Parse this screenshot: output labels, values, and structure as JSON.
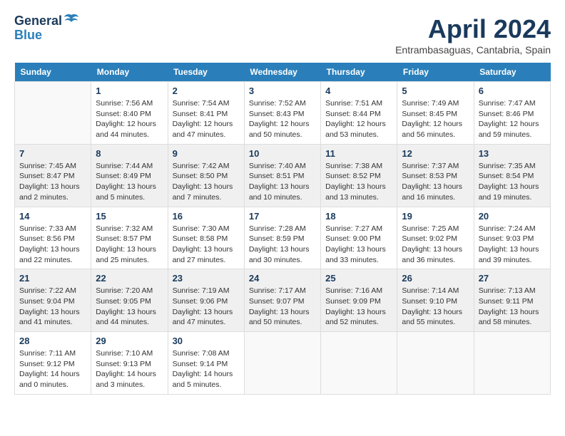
{
  "header": {
    "logo_line1": "General",
    "logo_line2": "Blue",
    "month_title": "April 2024",
    "location": "Entrambasaguas, Cantabria, Spain"
  },
  "days_of_week": [
    "Sunday",
    "Monday",
    "Tuesday",
    "Wednesday",
    "Thursday",
    "Friday",
    "Saturday"
  ],
  "weeks": [
    {
      "days": [
        {
          "number": "",
          "info": ""
        },
        {
          "number": "1",
          "info": "Sunrise: 7:56 AM\nSunset: 8:40 PM\nDaylight: 12 hours\nand 44 minutes."
        },
        {
          "number": "2",
          "info": "Sunrise: 7:54 AM\nSunset: 8:41 PM\nDaylight: 12 hours\nand 47 minutes."
        },
        {
          "number": "3",
          "info": "Sunrise: 7:52 AM\nSunset: 8:43 PM\nDaylight: 12 hours\nand 50 minutes."
        },
        {
          "number": "4",
          "info": "Sunrise: 7:51 AM\nSunset: 8:44 PM\nDaylight: 12 hours\nand 53 minutes."
        },
        {
          "number": "5",
          "info": "Sunrise: 7:49 AM\nSunset: 8:45 PM\nDaylight: 12 hours\nand 56 minutes."
        },
        {
          "number": "6",
          "info": "Sunrise: 7:47 AM\nSunset: 8:46 PM\nDaylight: 12 hours\nand 59 minutes."
        }
      ]
    },
    {
      "days": [
        {
          "number": "7",
          "info": "Sunrise: 7:45 AM\nSunset: 8:47 PM\nDaylight: 13 hours\nand 2 minutes."
        },
        {
          "number": "8",
          "info": "Sunrise: 7:44 AM\nSunset: 8:49 PM\nDaylight: 13 hours\nand 5 minutes."
        },
        {
          "number": "9",
          "info": "Sunrise: 7:42 AM\nSunset: 8:50 PM\nDaylight: 13 hours\nand 7 minutes."
        },
        {
          "number": "10",
          "info": "Sunrise: 7:40 AM\nSunset: 8:51 PM\nDaylight: 13 hours\nand 10 minutes."
        },
        {
          "number": "11",
          "info": "Sunrise: 7:38 AM\nSunset: 8:52 PM\nDaylight: 13 hours\nand 13 minutes."
        },
        {
          "number": "12",
          "info": "Sunrise: 7:37 AM\nSunset: 8:53 PM\nDaylight: 13 hours\nand 16 minutes."
        },
        {
          "number": "13",
          "info": "Sunrise: 7:35 AM\nSunset: 8:54 PM\nDaylight: 13 hours\nand 19 minutes."
        }
      ]
    },
    {
      "days": [
        {
          "number": "14",
          "info": "Sunrise: 7:33 AM\nSunset: 8:56 PM\nDaylight: 13 hours\nand 22 minutes."
        },
        {
          "number": "15",
          "info": "Sunrise: 7:32 AM\nSunset: 8:57 PM\nDaylight: 13 hours\nand 25 minutes."
        },
        {
          "number": "16",
          "info": "Sunrise: 7:30 AM\nSunset: 8:58 PM\nDaylight: 13 hours\nand 27 minutes."
        },
        {
          "number": "17",
          "info": "Sunrise: 7:28 AM\nSunset: 8:59 PM\nDaylight: 13 hours\nand 30 minutes."
        },
        {
          "number": "18",
          "info": "Sunrise: 7:27 AM\nSunset: 9:00 PM\nDaylight: 13 hours\nand 33 minutes."
        },
        {
          "number": "19",
          "info": "Sunrise: 7:25 AM\nSunset: 9:02 PM\nDaylight: 13 hours\nand 36 minutes."
        },
        {
          "number": "20",
          "info": "Sunrise: 7:24 AM\nSunset: 9:03 PM\nDaylight: 13 hours\nand 39 minutes."
        }
      ]
    },
    {
      "days": [
        {
          "number": "21",
          "info": "Sunrise: 7:22 AM\nSunset: 9:04 PM\nDaylight: 13 hours\nand 41 minutes."
        },
        {
          "number": "22",
          "info": "Sunrise: 7:20 AM\nSunset: 9:05 PM\nDaylight: 13 hours\nand 44 minutes."
        },
        {
          "number": "23",
          "info": "Sunrise: 7:19 AM\nSunset: 9:06 PM\nDaylight: 13 hours\nand 47 minutes."
        },
        {
          "number": "24",
          "info": "Sunrise: 7:17 AM\nSunset: 9:07 PM\nDaylight: 13 hours\nand 50 minutes."
        },
        {
          "number": "25",
          "info": "Sunrise: 7:16 AM\nSunset: 9:09 PM\nDaylight: 13 hours\nand 52 minutes."
        },
        {
          "number": "26",
          "info": "Sunrise: 7:14 AM\nSunset: 9:10 PM\nDaylight: 13 hours\nand 55 minutes."
        },
        {
          "number": "27",
          "info": "Sunrise: 7:13 AM\nSunset: 9:11 PM\nDaylight: 13 hours\nand 58 minutes."
        }
      ]
    },
    {
      "days": [
        {
          "number": "28",
          "info": "Sunrise: 7:11 AM\nSunset: 9:12 PM\nDaylight: 14 hours\nand 0 minutes."
        },
        {
          "number": "29",
          "info": "Sunrise: 7:10 AM\nSunset: 9:13 PM\nDaylight: 14 hours\nand 3 minutes."
        },
        {
          "number": "30",
          "info": "Sunrise: 7:08 AM\nSunset: 9:14 PM\nDaylight: 14 hours\nand 5 minutes."
        },
        {
          "number": "",
          "info": ""
        },
        {
          "number": "",
          "info": ""
        },
        {
          "number": "",
          "info": ""
        },
        {
          "number": "",
          "info": ""
        }
      ]
    }
  ]
}
